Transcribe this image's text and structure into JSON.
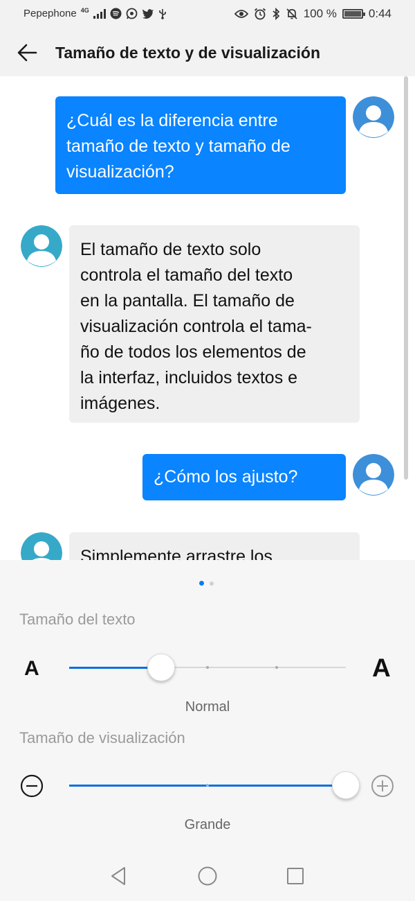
{
  "status_bar": {
    "carrier": "Pepephone",
    "network": "4G",
    "battery": "100 %",
    "battery_level": 1.0,
    "time": "0:44",
    "left_icons": [
      "signal-icon",
      "spotify-icon",
      "whatsapp-icon",
      "twitter-icon",
      "usb-icon"
    ],
    "right_icons": [
      "eye-icon",
      "alarm-icon",
      "bluetooth-icon",
      "mute-icon",
      "battery-icon"
    ]
  },
  "app_bar": {
    "title": "Tamaño de texto y de visualización",
    "back_icon": "arrow-left-icon"
  },
  "chat": {
    "messages": [
      {
        "sender": "user",
        "lines": [
          "¿Cuál es la diferencia entre",
          "tamaño de texto y tamaño de",
          "visualización?"
        ]
      },
      {
        "sender": "bot",
        "lines": [
          "El tamaño de texto solo",
          "controla el tamaño del texto",
          "en la pantalla. El tamaño de",
          "visualización controla el tama-",
          "ño de todos los elementos de",
          "la interfaz, incluidos textos e",
          "imágenes."
        ]
      },
      {
        "sender": "user",
        "lines": [
          "¿Cómo los ajusto?"
        ]
      },
      {
        "sender": "bot",
        "lines": [
          "Simplemente arrastre los"
        ]
      }
    ]
  },
  "pager": {
    "pages": 2,
    "current": 1
  },
  "text_size": {
    "label": "Tamaño del texto",
    "small_glyph": "A",
    "large_glyph": "A",
    "steps": 4,
    "selected_index": 1,
    "value_label": "Normal"
  },
  "display_size": {
    "label": "Tamaño de visualización",
    "decrease_icon": "minus-circle-icon",
    "increase_icon": "plus-circle-icon",
    "steps": 3,
    "selected_index": 2,
    "value_label": "Grande"
  },
  "nav_bar": {
    "buttons": [
      "back-triangle-icon",
      "home-circle-icon",
      "recents-square-icon"
    ]
  },
  "colors": {
    "accent": "#0a84ff",
    "slider_fill": "#0a6fe0",
    "avatar_user": "#3d8fd9",
    "avatar_bot": "#36a9c9",
    "bubble_bot": "#efefef",
    "label_gray": "#9a9a9a"
  }
}
